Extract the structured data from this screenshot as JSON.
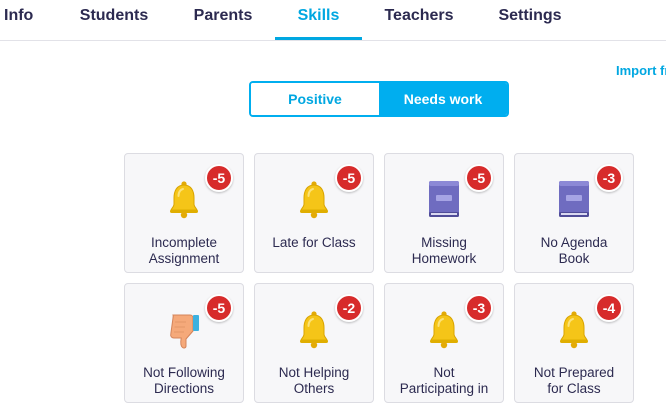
{
  "tabs": [
    {
      "label": "Info"
    },
    {
      "label": "Students"
    },
    {
      "label": "Parents"
    },
    {
      "label": "Skills",
      "active": true
    },
    {
      "label": "Teachers"
    },
    {
      "label": "Settings"
    }
  ],
  "import_link": "Import fr",
  "segment": {
    "positive": "Positive",
    "needs_work": "Needs work",
    "selected": "needs_work"
  },
  "colors": {
    "accent": "#00aeef",
    "badge": "#d72b2b",
    "bell": "#f5c518",
    "book": "#6f6cc0",
    "thumb": "#f5a97a"
  },
  "skills": [
    {
      "line1": "Incomplete",
      "line2": "Assignment",
      "points": "-5",
      "icon": "bell-icon"
    },
    {
      "line1": "Late for Class",
      "line2": "",
      "points": "-5",
      "icon": "bell-icon"
    },
    {
      "line1": "Missing",
      "line2": "Homework",
      "points": "-5",
      "icon": "book-icon"
    },
    {
      "line1": "No Agenda",
      "line2": "Book",
      "points": "-3",
      "icon": "book-icon"
    },
    {
      "line1": "Not Following",
      "line2": "Directions",
      "points": "-5",
      "icon": "thumbs-down-icon"
    },
    {
      "line1": "Not Helping",
      "line2": "Others",
      "points": "-2",
      "icon": "bell-icon"
    },
    {
      "line1": "Not",
      "line2": "Participating in",
      "points": "-3",
      "icon": "bell-icon"
    },
    {
      "line1": "Not Prepared",
      "line2": "for Class",
      "points": "-4",
      "icon": "bell-icon"
    }
  ]
}
